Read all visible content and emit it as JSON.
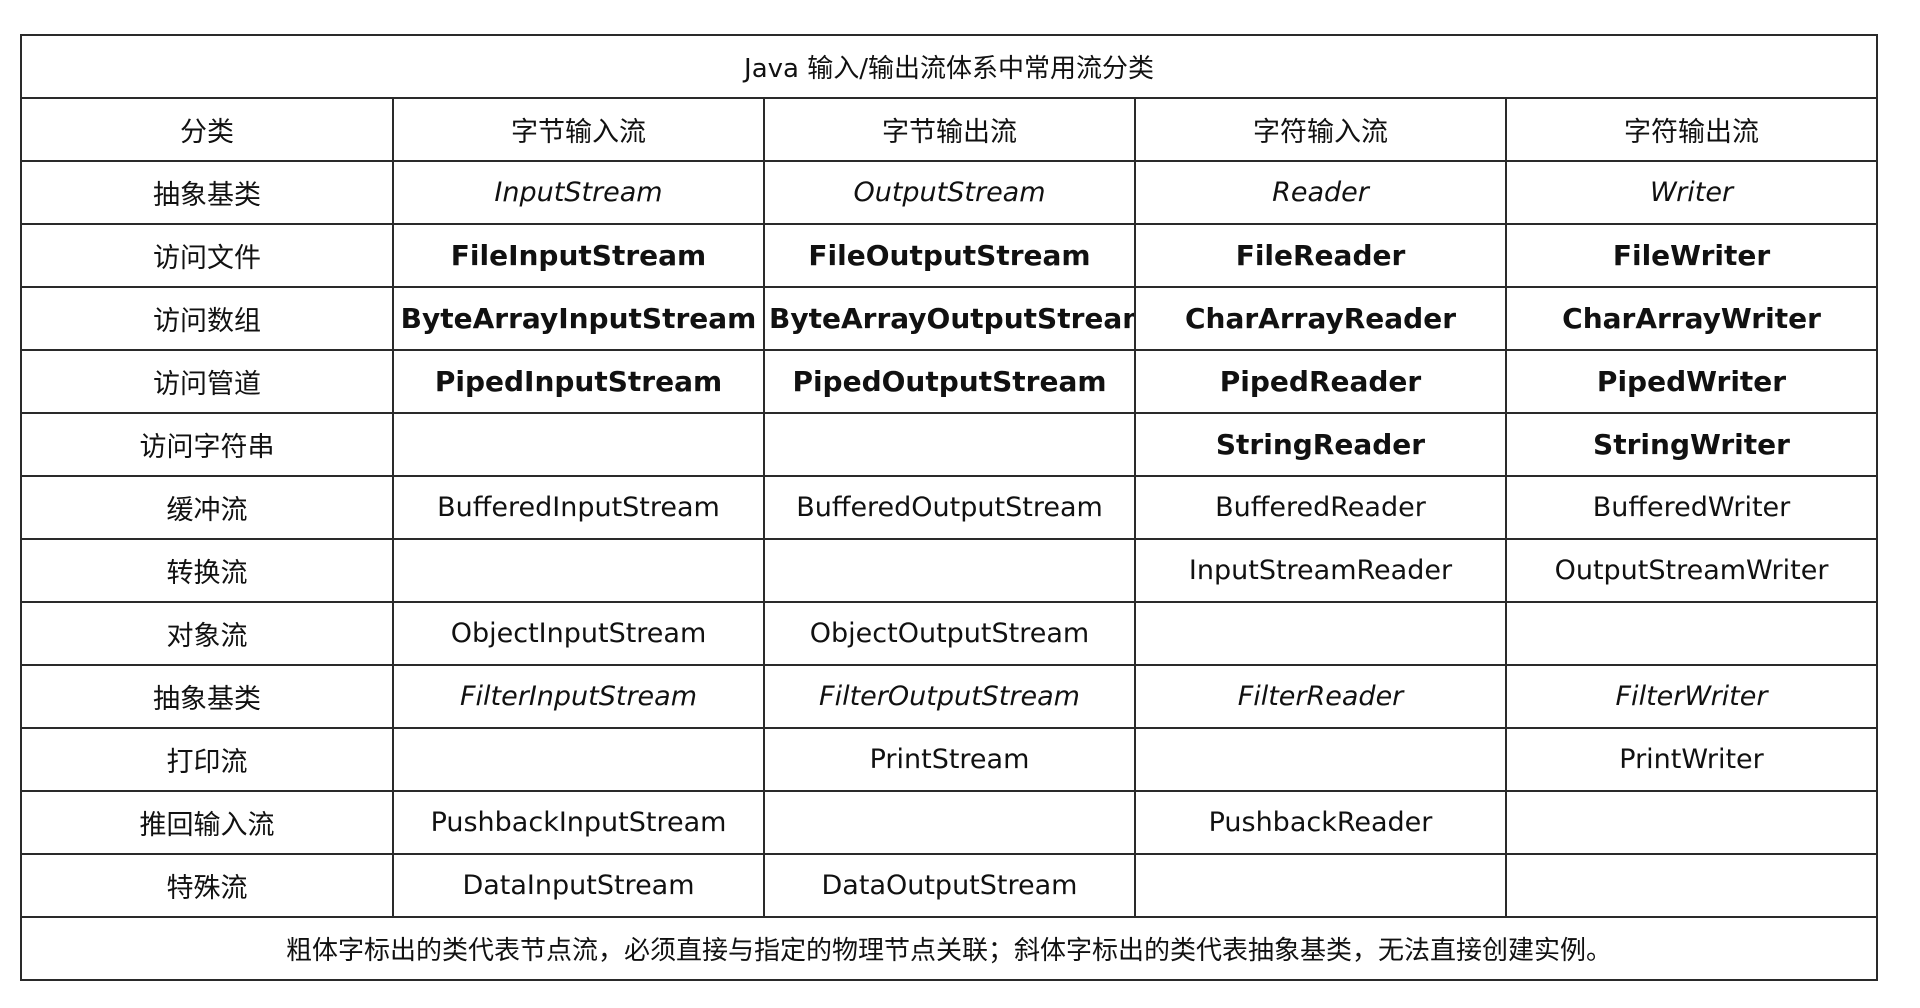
{
  "table": {
    "title": "Java 输入/输出流体系中常用流分类",
    "headers": [
      "分类",
      "字节输入流",
      "字节输出流",
      "字符输入流",
      "字符输出流"
    ],
    "rows": [
      {
        "label": "抽象基类",
        "style": "italic",
        "cells": [
          "InputStream",
          "OutputStream",
          "Reader",
          "Writer"
        ]
      },
      {
        "label": "访问文件",
        "style": "bold",
        "cells": [
          "FileInputStream",
          "FileOutputStream",
          "FileReader",
          "FileWriter"
        ]
      },
      {
        "label": "访问数组",
        "style": "bold",
        "cells": [
          "ByteArrayInputStream",
          "ByteArrayOutputStream",
          "CharArrayReader",
          "CharArrayWriter"
        ]
      },
      {
        "label": "访问管道",
        "style": "bold",
        "cells": [
          "PipedInputStream",
          "PipedOutputStream",
          "PipedReader",
          "PipedWriter"
        ]
      },
      {
        "label": "访问字符串",
        "style": "bold",
        "cells": [
          "",
          "",
          "StringReader",
          "StringWriter"
        ]
      },
      {
        "label": "缓冲流",
        "style": "normal",
        "cells": [
          "BufferedInputStream",
          "BufferedOutputStream",
          "BufferedReader",
          "BufferedWriter"
        ]
      },
      {
        "label": "转换流",
        "style": "normal",
        "cells": [
          "",
          "",
          "InputStreamReader",
          "OutputStreamWriter"
        ]
      },
      {
        "label": "对象流",
        "style": "normal",
        "cells": [
          "ObjectInputStream",
          "ObjectOutputStream",
          "",
          ""
        ]
      },
      {
        "label": "抽象基类",
        "style": "italic",
        "cells": [
          "FilterInputStream",
          "FilterOutputStream",
          "FilterReader",
          "FilterWriter"
        ]
      },
      {
        "label": "打印流",
        "style": "normal",
        "cells": [
          "",
          "PrintStream",
          "",
          "PrintWriter"
        ]
      },
      {
        "label": "推回输入流",
        "style": "normal",
        "cells": [
          "PushbackInputStream",
          "",
          "PushbackReader",
          ""
        ]
      },
      {
        "label": "特殊流",
        "style": "normal",
        "cells": [
          "DataInputStream",
          "DataOutputStream",
          "",
          ""
        ]
      }
    ],
    "footnote": "粗体字标出的类代表节点流，必须直接与指定的物理节点关联；斜体字标出的类代表抽象基类，无法直接创建实例。"
  }
}
